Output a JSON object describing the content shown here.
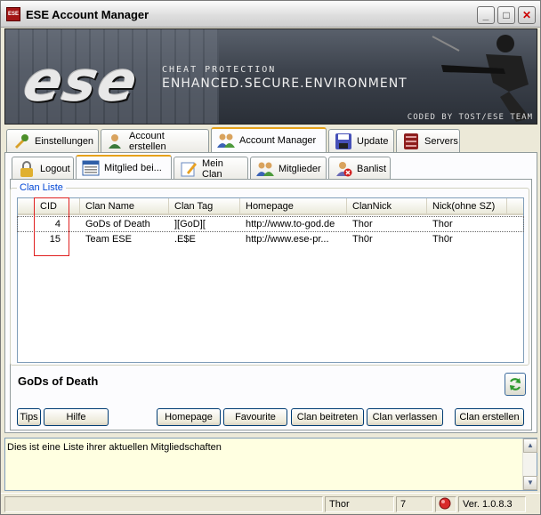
{
  "window": {
    "title": "ESE Account Manager"
  },
  "banner": {
    "logo": "ese",
    "tagline_small": "CHEAT PROTECTION",
    "tagline_large": "ENHANCED.SECURE.ENVIRONMENT",
    "coder": "CODED BY TOST/ESE TEAM"
  },
  "main_tabs": [
    {
      "label": "Einstellungen",
      "icon": "tools-icon"
    },
    {
      "label": "Account erstellen",
      "icon": "user-add-icon"
    },
    {
      "label": "Account Manager",
      "icon": "users-icon"
    },
    {
      "label": "Update",
      "icon": "floppy-icon"
    },
    {
      "label": "Servers",
      "icon": "server-icon"
    }
  ],
  "sub_tabs": [
    {
      "label": "Logout",
      "icon": "lock-icon"
    },
    {
      "label": "Mitglied bei...",
      "icon": "list-icon"
    },
    {
      "label": "Mein Clan",
      "icon": "edit-icon"
    },
    {
      "label": "Mitglieder",
      "icon": "users-icon"
    },
    {
      "label": "Banlist",
      "icon": "ban-icon"
    }
  ],
  "clan_list": {
    "group_label": "Clan Liste",
    "columns": [
      "CID",
      "Clan Name",
      "Clan Tag",
      "Homepage",
      "ClanNick",
      "Nick(ohne SZ)"
    ],
    "rows": [
      {
        "cid": "4",
        "name": "GoDs of Death",
        "tag": "][GoD][",
        "homepage": "http://www.to-god.de",
        "clannick": "Thor",
        "nick": "Thor"
      },
      {
        "cid": "15",
        "name": "Team ESE",
        "tag": ".E$E",
        "homepage": "http://www.ese-pr...",
        "clannick": "Th0r",
        "nick": "Th0r"
      }
    ]
  },
  "selected_clan": "GoDs of Death",
  "buttons": {
    "tips": "Tips",
    "hilfe": "Hilfe",
    "homepage": "Homepage",
    "favourite": "Favourite",
    "beitreten": "Clan beitreten",
    "verlassen": "Clan verlassen",
    "erstellen": "Clan erstellen"
  },
  "log": {
    "text": "Dies ist eine Liste ihrer aktuellen Mitgliedschaften"
  },
  "status": {
    "user": "Thor",
    "count": "7",
    "version": "Ver. 1.0.8.3"
  }
}
